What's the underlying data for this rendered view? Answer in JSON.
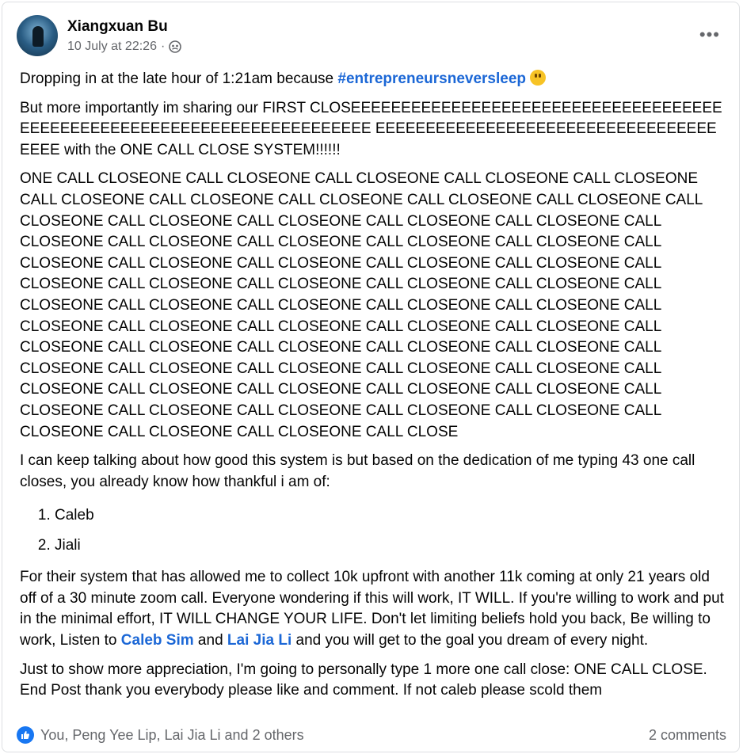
{
  "post": {
    "author": "Xiangxuan Bu",
    "timestamp": "10 July at 22:26",
    "separator": "·",
    "more_label": "•••",
    "p1_before": "Dropping in at the late hour of 1:21am because ",
    "p1_hashtag": "#entrepreneursneversleep",
    "p2": "But more importantly im sharing our FIRST CLOSEEEEEEEEEEEEEEEEEEEEEEEEEEEEEEEEEEEEEEEEEEEEEEEEEEEEEEEEEEEEEEEEEEEEEEEE EEEEEEEEEEEEEEEEEEEEEEEEEEEEEEEEEEEEEE with the ONE CALL CLOSE SYSTEM!!!!!!",
    "p3": "ONE CALL CLOSEONE CALL CLOSEONE CALL CLOSEONE CALL CLOSEONE CALL CLOSEONE CALL CLOSEONE CALL CLOSEONE CALL CLOSEONE CALL CLOSEONE CALL CLOSEONE CALL CLOSEONE CALL CLOSEONE CALL CLOSEONE CALL CLOSEONE CALL CLOSEONE CALL CLOSEONE CALL CLOSEONE CALL CLOSEONE CALL CLOSEONE CALL CLOSEONE CALL CLOSEONE CALL CLOSEONE CALL CLOSEONE CALL CLOSEONE CALL CLOSEONE CALL CLOSEONE CALL CLOSEONE CALL CLOSEONE CALL CLOSEONE CALL CLOSEONE CALL CLOSEONE CALL CLOSEONE CALL CLOSEONE CALL CLOSEONE CALL CLOSEONE CALL CLOSEONE CALL CLOSEONE CALL CLOSEONE CALL CLOSEONE CALL CLOSEONE CALL CLOSEONE CALL CLOSEONE CALL CLOSEONE CALL CLOSEONE CALL CLOSEONE CALL CLOSEONE CALL CLOSEONE CALL CLOSEONE CALL CLOSEONE CALL CLOSEONE CALL CLOSEONE CALL CLOSEONE CALL CLOSEONE CALL CLOSEONE CALL CLOSEONE CALL CLOSEONE CALL CLOSEONE CALL CLOSEONE CALL CLOSEONE CALL CLOSEONE CALL CLOSEONE CALL CLOSEONE CALL CLOSEONE CALL CLOSE",
    "p4": "I can keep talking about how good this system is but based on the dedication of me typing 43 one call closes, you already know how thankful i am of:",
    "list": [
      "Caleb",
      "Jiali"
    ],
    "p5_a": "For their system that has allowed me to collect 10k upfront with another 11k coming at only 21 years old off of a 30 minute zoom call. Everyone wondering if this will work, IT WILL. If you're willing to work and put in the minimal effort, IT WILL CHANGE YOUR LIFE. Don't let limiting beliefs hold you back, Be willing to work, Listen to ",
    "mention1": "Caleb Sim",
    "p5_b": " and ",
    "mention2": "Lai Jia Li",
    "p5_c": " and you will get to the goal you dream of every night.",
    "p6": "Just to show more appreciation, I'm going to personally type 1 more one call close: ONE CALL CLOSE. End Post thank you everybody please like and comment. If not caleb please scold them"
  },
  "footer": {
    "reactions": "You, Peng Yee Lip, Lai Jia Li and 2 others",
    "comments": "2 comments"
  },
  "colors": {
    "link": "#1b67d6",
    "like": "#1877f2",
    "secondary_text": "#65676b"
  }
}
